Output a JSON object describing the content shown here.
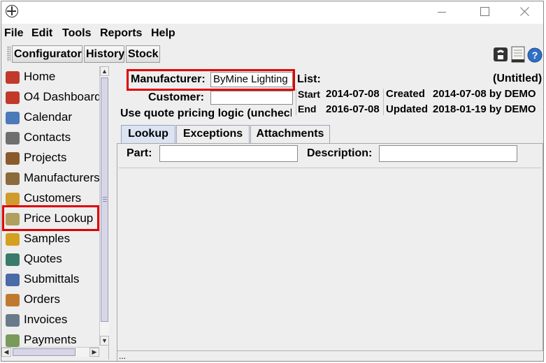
{
  "menu": {
    "file": "File",
    "edit": "Edit",
    "tools": "Tools",
    "reports": "Reports",
    "help": "Help"
  },
  "toolbar": {
    "configurator": "Configurator",
    "history": "History",
    "stock": "Stock",
    "help_icon_text": "?"
  },
  "sidebar": {
    "items": [
      {
        "label": "Home",
        "icon": "home-icon",
        "color": "#c0392b"
      },
      {
        "label": "O4 Dashboard",
        "icon": "dashboard-icon",
        "color": "#c0392b"
      },
      {
        "label": "Calendar",
        "icon": "calendar-icon",
        "color": "#4a7ab8"
      },
      {
        "label": "Contacts",
        "icon": "contacts-icon",
        "color": "#6f6f6f"
      },
      {
        "label": "Projects",
        "icon": "projects-icon",
        "color": "#8b5a2b"
      },
      {
        "label": "Manufacturers",
        "icon": "manufacturers-icon",
        "color": "#8b6a3b"
      },
      {
        "label": "Customers",
        "icon": "customers-icon",
        "color": "#d09b2c"
      },
      {
        "label": "Price Lookup",
        "icon": "price-lookup-icon",
        "color": "#b0a060"
      },
      {
        "label": "Samples",
        "icon": "samples-icon",
        "color": "#d4a020"
      },
      {
        "label": "Quotes",
        "icon": "quotes-icon",
        "color": "#3a7a6a"
      },
      {
        "label": "Submittals",
        "icon": "submittals-icon",
        "color": "#4a6aa8"
      },
      {
        "label": "Orders",
        "icon": "orders-icon",
        "color": "#c07a30"
      },
      {
        "label": "Invoices",
        "icon": "invoices-icon",
        "color": "#6a7a8a"
      },
      {
        "label": "Payments",
        "icon": "payments-icon",
        "color": "#7a9a5a"
      }
    ]
  },
  "form": {
    "manufacturer_label": "Manufacturer:",
    "manufacturer_value": "ByMine Lighting",
    "customer_label": "Customer:",
    "customer_value": "",
    "quote_pricing_text": "Use quote pricing logic (unchecked)"
  },
  "list_info": {
    "list_label": "List:",
    "list_name": "(Untitled)",
    "start_label": "Start",
    "start_date": "2014-07-08",
    "end_label": "End",
    "end_date": "2016-07-08",
    "created_label": "Created",
    "created_value": "2014-07-08 by DEMO",
    "updated_label": "Updated",
    "updated_value": "2018-01-19 by DEMO"
  },
  "tabs": [
    "Lookup",
    "Exceptions",
    "Attachments"
  ],
  "lookup": {
    "part_label": "Part:",
    "part_value": "",
    "description_label": "Description:",
    "description_value": ""
  },
  "status_text": "...",
  "colors": {
    "highlight": "#e00000",
    "active_tab": "#dbe4f2"
  }
}
